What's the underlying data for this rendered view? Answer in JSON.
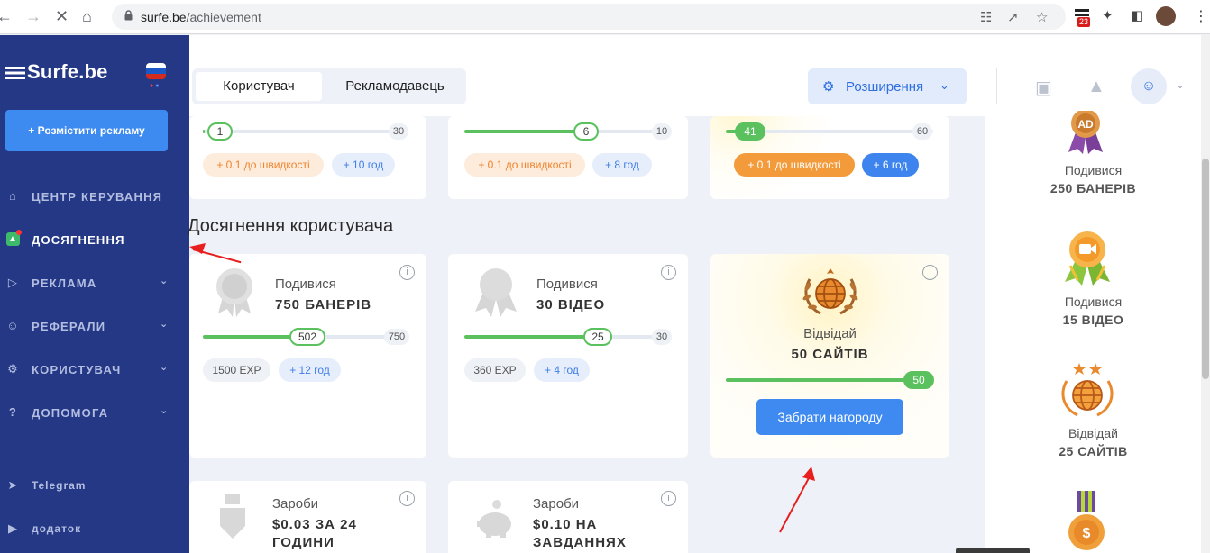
{
  "browser": {
    "url_host": "surfe.be",
    "url_path": "/achievement",
    "ext_badge": "23"
  },
  "sidebar": {
    "logo": "Surfe.be",
    "post_button": "+ Розмістити рекламу",
    "items": [
      {
        "label": "ЦЕНТР КЕРУВАННЯ",
        "icon": "home-icon"
      },
      {
        "label": "ДОСЯГНЕННЯ",
        "icon": "trophy-icon"
      },
      {
        "label": "РЕКЛАМА",
        "icon": "megaphone-icon"
      },
      {
        "label": "РЕФЕРАЛИ",
        "icon": "users-icon"
      },
      {
        "label": "КОРИСТУВАЧ",
        "icon": "gear-icon"
      },
      {
        "label": "ДОПОМОГА",
        "icon": "help-icon"
      }
    ],
    "links": [
      {
        "label": "Telegram",
        "icon": "telegram-icon"
      },
      {
        "label": "додаток",
        "icon": "play-icon"
      }
    ]
  },
  "topbar": {
    "tabs": [
      "Користувач",
      "Рекламодавець"
    ],
    "extensions_button": "Розширення"
  },
  "top_cards": [
    {
      "value": "1",
      "max": "30",
      "progress": 0.03,
      "speed": "+ 0.1  до швидкості",
      "hours": "+ 10  год"
    },
    {
      "value": "6",
      "max": "10",
      "progress": 0.6,
      "speed": "+ 0.1  до швидкості",
      "hours": "+ 8  год"
    },
    {
      "value": "41",
      "max": "60",
      "progress": 0.68,
      "speed": "+ 0.1  до швидкості",
      "hours": "+ 6  год"
    }
  ],
  "section_title": "Досягнення користувача",
  "achievements": [
    {
      "title": "Подивися",
      "subtitle": "750 БАНЕРІВ",
      "value": "502",
      "max": "750",
      "progress": 0.67,
      "exp": "1500  EXP",
      "hours": "+ 12  год",
      "icon": "medal-icon"
    },
    {
      "title": "Подивися",
      "subtitle": "30 ВІДЕО",
      "value": "25",
      "max": "30",
      "progress": 0.83,
      "exp": "360  EXP",
      "hours": "+ 4  год",
      "icon": "badge-icon"
    },
    {
      "title": "Відвідай",
      "subtitle": "50 САЙТІВ",
      "value": "50",
      "progress": 1.0,
      "claim": "Забрати нагороду",
      "icon": "globe-laurel-icon"
    }
  ],
  "earn_cards": [
    {
      "title": "Зароби",
      "subtitle_1": "$0.03 ЗА 24",
      "subtitle_2": "ГОДИНИ",
      "icon": "shield-icon"
    },
    {
      "title": "Зароби",
      "subtitle_1": "$0.10 НА",
      "subtitle_2": "ЗАВДАННЯХ",
      "icon": "piggy-bank-icon"
    }
  ],
  "right_panel": [
    {
      "title": "Подивися",
      "subtitle": "250 БАНЕРІВ",
      "icon": "ad-medal-icon"
    },
    {
      "title": "Подивися",
      "subtitle": "15 ВІДЕО",
      "icon": "video-medal-icon"
    },
    {
      "title": "Відвідай",
      "subtitle": "25 САЙТІВ",
      "icon": "globe-stars-icon"
    },
    {
      "title": "",
      "subtitle": "",
      "icon": "coin-medal-icon"
    }
  ],
  "colors": {
    "sidebar": "#243885",
    "accent_blue": "#3e8af0",
    "progress_green": "#5bc15e",
    "orange": "#f0832d",
    "annotation_red": "#e81f1f"
  }
}
